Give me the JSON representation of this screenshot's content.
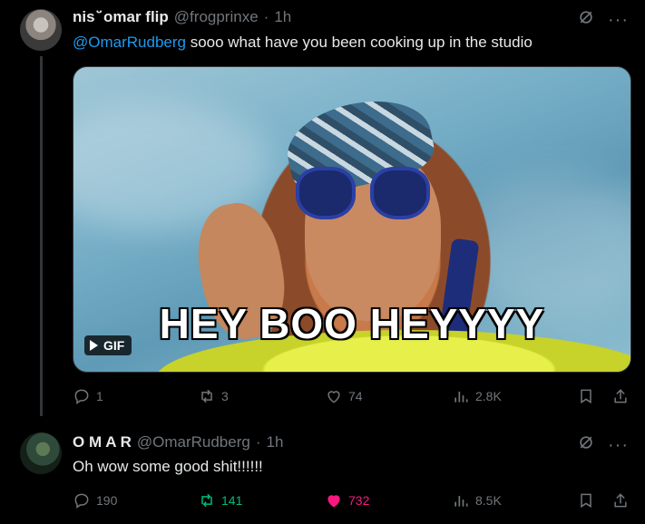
{
  "tweets": [
    {
      "author_name": "nis ̈̆ omar flip",
      "handle": "@frogprinxe",
      "separator": "·",
      "time": "1h",
      "mention": "@OmarRudberg",
      "text": " sooo what have you been cooking up in the studio",
      "media": {
        "caption": "HEY BOO HEYYYY",
        "badge": "GIF"
      },
      "stats": {
        "replies": "1",
        "reposts": "3",
        "likes": "74",
        "views": "2.8K"
      }
    },
    {
      "author_name": "O M A R",
      "handle": "@OmarRudberg",
      "separator": "·",
      "time": "1h",
      "text": "Oh wow some good shit!!!!!!",
      "stats": {
        "replies": "190",
        "reposts": "141",
        "likes": "732",
        "views": "8.5K"
      }
    }
  ],
  "icons": {
    "reply": "reply-icon",
    "repost": "repost-icon",
    "like": "heart-icon",
    "views": "views-icon",
    "bookmark": "bookmark-icon",
    "share": "share-icon",
    "grok": "grok-icon",
    "more": "more-icon"
  },
  "colors": {
    "background": "#000000",
    "text": "#e7e9ea",
    "muted": "#71767b",
    "link": "#1d9bf0",
    "repost_active": "#00ba7c",
    "like_active": "#f91880"
  }
}
